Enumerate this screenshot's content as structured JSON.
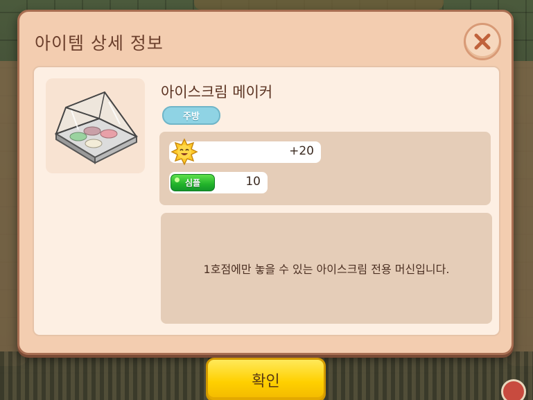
{
  "dialog": {
    "title": "아이템 상세 정보",
    "close_icon": "close-x-icon"
  },
  "item": {
    "image_icon": "ice-cream-display-case-icon",
    "name": "아이스크림 메이커",
    "category": "주방",
    "stats": {
      "satisfaction_icon": "smiling-sun-icon",
      "satisfaction_value": "+20",
      "style_label": "심플",
      "style_value": "10"
    },
    "description": "1호점에만 놓을 수 있는 아이스크림 전용 머신입니다."
  },
  "confirm_label": "확인",
  "colors": {
    "dialog_bg": "#f3cdb0",
    "content_bg": "#fdefe3",
    "category_badge": "#8fd3e4",
    "style_tag": "#22b32a",
    "confirm_button": "#ffd000",
    "close_x": "#c0623b"
  }
}
